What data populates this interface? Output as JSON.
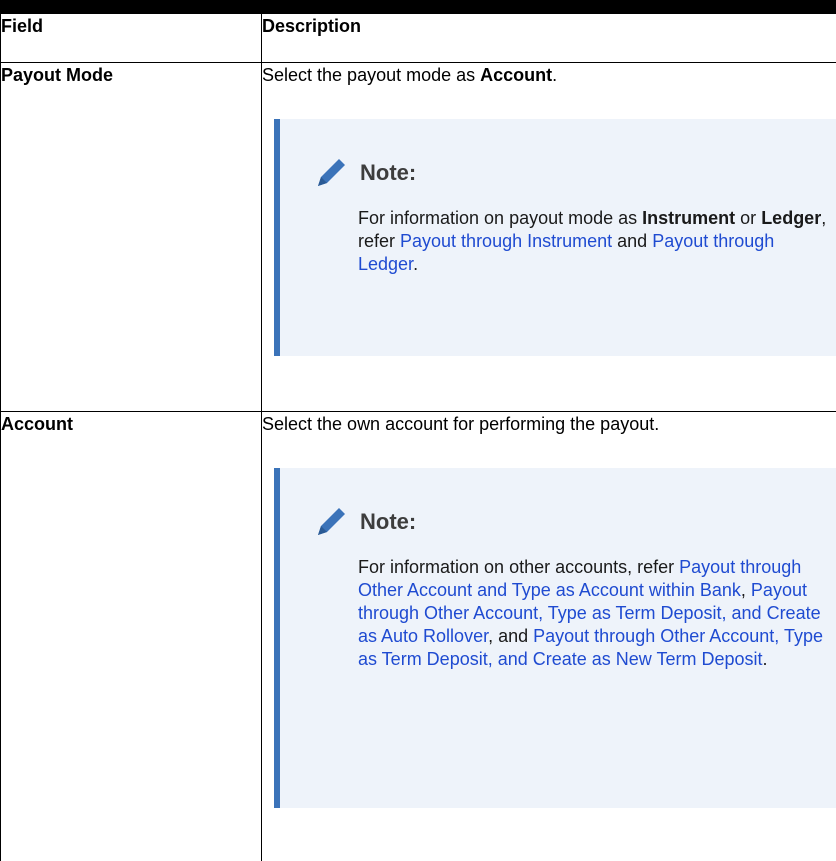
{
  "table": {
    "header": {
      "field": "Field",
      "description": "Description"
    },
    "rows": [
      {
        "field": "Payout Mode",
        "description_pre": "Select the payout mode as ",
        "description_bold": "Account",
        "description_post": ".",
        "note": {
          "title": "Note:",
          "text_1": "For information on payout mode as ",
          "bold_1": "Instrument",
          "text_2": " or ",
          "bold_2": "Ledger",
          "text_3": ", refer ",
          "link_1": "Payout through Instrument",
          "text_4": " and ",
          "link_2": "Payout through Ledger",
          "text_5": "."
        }
      },
      {
        "field": "Account",
        "description": "Select the own account for performing the payout.",
        "note": {
          "title": "Note:",
          "text_1": "For information on other accounts, refer ",
          "link_1": "Payout through Other Account and Type as Account within Bank",
          "text_2": ", ",
          "link_2": "Payout through Other Account, Type as Term Deposit, and Create as Auto Rollover",
          "text_3": ", and ",
          "link_3": "Payout through Other Account, Type as Term Deposit, and Create as New Term Deposit",
          "text_4": "."
        }
      }
    ]
  },
  "colors": {
    "link": "#1f4bd1",
    "note_accent": "#3b73b9",
    "note_background": "#eef3fa"
  },
  "icons": {
    "note_icon": "pencil-icon"
  }
}
